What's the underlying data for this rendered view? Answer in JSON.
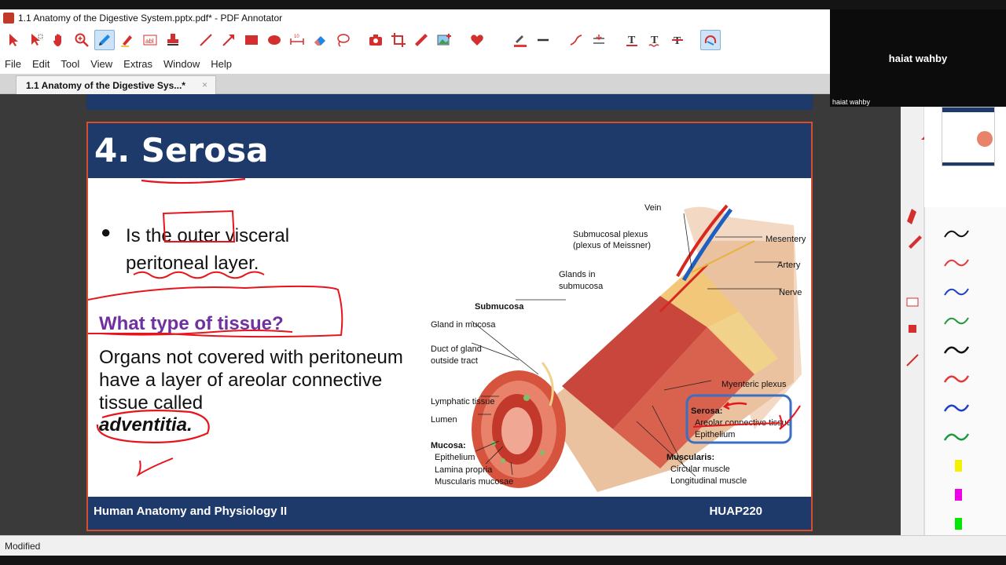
{
  "window": {
    "title": "1.1 Anatomy of the Digestive System.pptx.pdf* - PDF Annotator"
  },
  "menu": [
    "File",
    "Edit",
    "Tool",
    "View",
    "Extras",
    "Window",
    "Help"
  ],
  "tab": {
    "label": "1.1 Anatomy of the Digestive Sys...*",
    "close": "×"
  },
  "slide": {
    "title": "4. Serosa",
    "bullet": "●",
    "bullet_text": "Is the outer visceral peritoneal layer.",
    "question": "What type of tissue?",
    "answer": "Organs not covered with peritoneum have a layer  of areolar connective  tissue called",
    "answer_emphasis": "adventitia.",
    "footer_left": "Human Anatomy and Physiology II",
    "footer_right": "HUAP220"
  },
  "figure": {
    "labels": {
      "vein": "Vein",
      "submucosal_plexus": "Submucosal plexus",
      "plexus_meissner": "(plexus of Meissner)",
      "mesentery": "Mesentery",
      "artery": "Artery",
      "glands_in": "Glands in",
      "submucosa_sub": "submucosa",
      "nerve": "Nerve",
      "submucosa": "Submucosa",
      "gland_in_mucosa": "Gland in mucosa",
      "duct_of_gland": "Duct of gland",
      "outside_tract": "outside tract",
      "myenteric_plexus": "Myenteric plexus",
      "lymphatic_tissue": "Lymphatic tissue",
      "lumen": "Lumen",
      "serosa": "Serosa:",
      "areolar_connective_tissue": "Areolar connective tissue",
      "epithelium_serosa": "Epithelium",
      "mucosa": "Mucosa:",
      "epithelium": "Epithelium",
      "lamina_propria": "Lamina propria",
      "muscularis_mucosae": "Muscularis mucosae",
      "muscularis": "Muscularis:",
      "circular_muscle": "Circular muscle",
      "longitudinal_muscle": "Longitudinal muscle"
    }
  },
  "video": {
    "participant": "haiat wahby",
    "participant_small": "haiat wahby"
  },
  "status": {
    "text": "Modified"
  },
  "colors": {
    "header_blue": "#1e3a6b",
    "slide_border": "#d94f2b",
    "question_purple": "#7030a0",
    "ink_red": "#e8141c",
    "highlight_box": "#3a6fc4"
  },
  "toolbar_icons": [
    "pointer-icon",
    "select-icon",
    "hand-icon",
    "zoom-icon",
    "pen-icon",
    "highlighter-icon",
    "text-box-icon",
    "stamp-icon",
    "line-icon",
    "arrow-icon",
    "rectangle-icon",
    "ellipse-icon",
    "measure-icon",
    "eraser-icon",
    "lasso-icon",
    "camera-icon",
    "crop-icon",
    "ruler-icon",
    "insert-image-icon",
    "favorite-heart-icon",
    "pen-color-icon",
    "line-style-icon",
    "curve-icon",
    "insert-space-icon",
    "text-underline-icon",
    "text-wavy-icon",
    "text-strike-icon",
    "presentation-icon"
  ]
}
